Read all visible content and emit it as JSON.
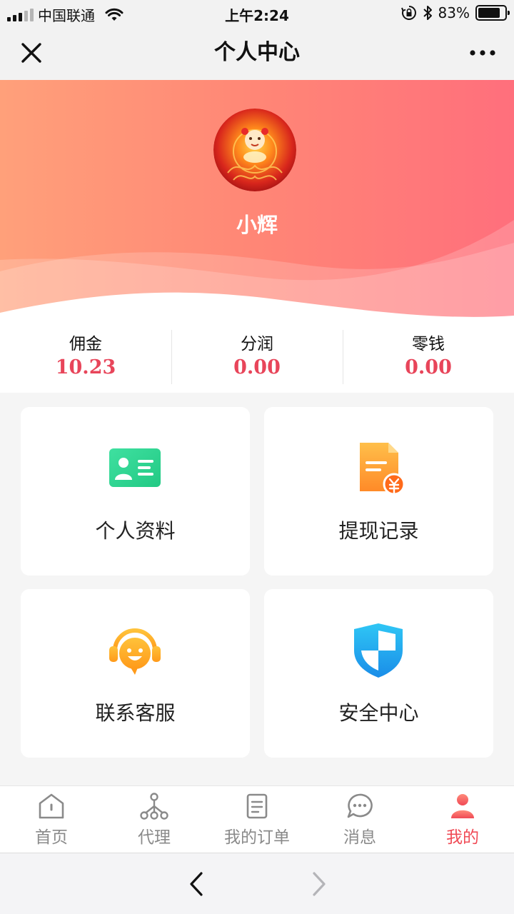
{
  "status_bar": {
    "carrier": "中国联通",
    "time": "上午2:24",
    "battery": "83%",
    "battery_level": 0.83
  },
  "nav": {
    "title": "个人中心",
    "close_icon": "close-icon",
    "more_icon": "more-icon"
  },
  "profile": {
    "username": "小辉"
  },
  "stats": [
    {
      "label": "佣金",
      "value": "10.23"
    },
    {
      "label": "分润",
      "value": "0.00"
    },
    {
      "label": "零钱",
      "value": "0.00"
    }
  ],
  "menu": [
    {
      "label": "个人资料",
      "icon": "id-card-icon"
    },
    {
      "label": "提现记录",
      "icon": "withdraw-record-icon"
    },
    {
      "label": "联系客服",
      "icon": "customer-service-icon"
    },
    {
      "label": "安全中心",
      "icon": "shield-icon"
    }
  ],
  "tabs": [
    {
      "label": "首页",
      "icon": "home-icon"
    },
    {
      "label": "代理",
      "icon": "agent-tree-icon"
    },
    {
      "label": "我的订单",
      "icon": "orders-icon"
    },
    {
      "label": "消息",
      "icon": "message-icon"
    },
    {
      "label": "我的",
      "icon": "user-icon",
      "active": true
    }
  ],
  "colors": {
    "accent": "#f04a55",
    "stat_value": "#e8455a",
    "header_start": "#ffa07a",
    "header_end": "#ff6f7c"
  }
}
